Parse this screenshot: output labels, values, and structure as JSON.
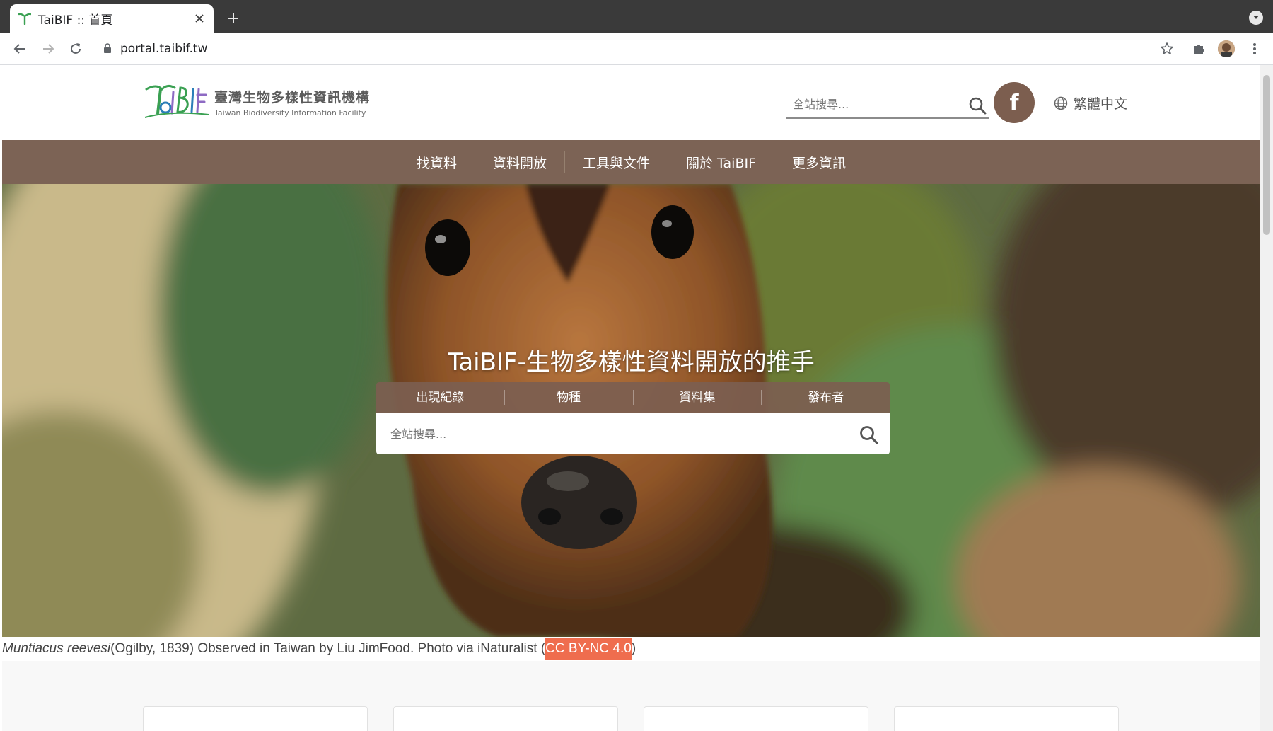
{
  "browser": {
    "tab_title": "TaiBIF :: 首頁",
    "url": "portal.taibif.tw"
  },
  "site": {
    "logo_text_zh": "臺灣生物多樣性資訊機構",
    "logo_text_en": "Taiwan Biodiversity Information Facility",
    "header_search_placeholder": "全站搜尋...",
    "facebook_label": "f",
    "language": "繁體中文",
    "nav": [
      "找資料",
      "資料開放",
      "工具與文件",
      "關於 TaiBIF",
      "更多資訊"
    ]
  },
  "hero": {
    "title": "TaiBIF-生物多樣性資料開放的推手",
    "tabs": [
      "出現紀錄",
      "物種",
      "資料集",
      "發布者"
    ],
    "search_placeholder": "全站搜尋..."
  },
  "caption": {
    "species": "Muntiacus reevesi",
    "text": " (Ogilby, 1839) Observed in Taiwan by Liu JimFood. Photo via iNaturalist (",
    "license": "CC BY-NC 4.0",
    "close": ")"
  },
  "colors": {
    "brand_brown": "#7c6355",
    "license_orange": "#ef6d4e"
  }
}
